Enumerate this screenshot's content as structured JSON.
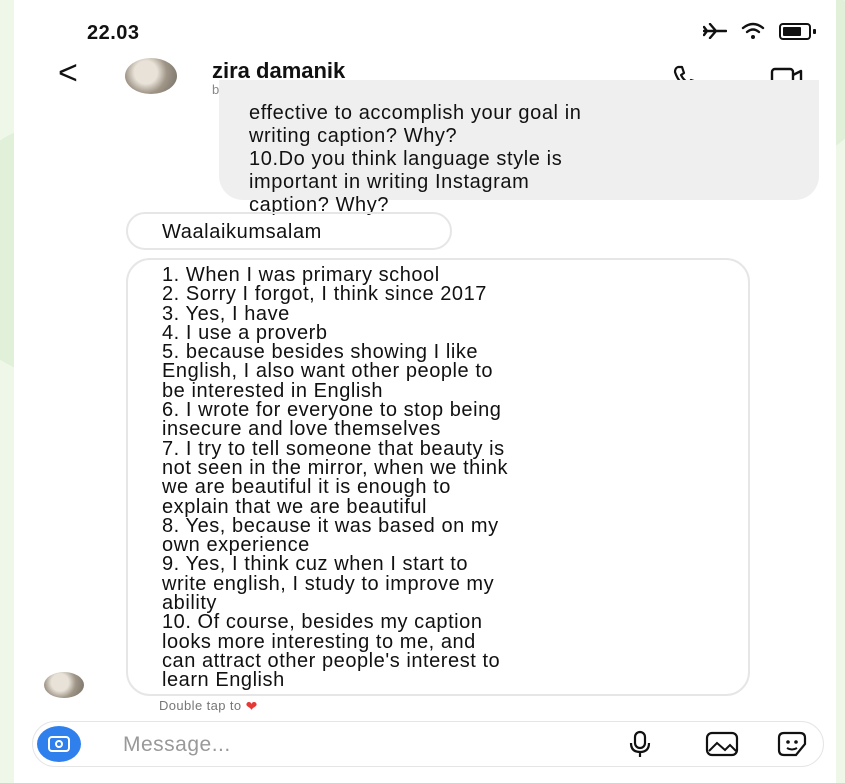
{
  "status_bar": {
    "time": "22.03"
  },
  "header": {
    "name": "zira damanik",
    "handle": "belleviezira"
  },
  "conversation": {
    "sent_text": "effective to accomplish your goal in\nwriting caption? Why?\n10.Do you think language style is\nimportant in writing Instagram\ncaption? Why?",
    "reply_short": "Waalaikumsalam",
    "answer_lines": [
      "1. When I was primary school",
      "2. Sorry I forgot, I think since 2017",
      "3. Yes, I have",
      "4. I use a proverb",
      "5. because besides showing I like",
      "English, I also want other people to",
      "be interested in English",
      "6. I wrote for everyone to stop being",
      "insecure and love themselves",
      "7. I try to tell someone that beauty is",
      "not seen in the mirror, when we think",
      "we are beautiful it is enough to",
      "explain that we are beautiful",
      "8. Yes, because it was based on my",
      "own experience",
      "9. Yes, I think cuz when I start to",
      "write english, I study to improve my",
      "ability",
      "10. Of course, besides my caption",
      "looks more interesting to me, and",
      "can attract other people's interest to",
      "learn English"
    ],
    "hint": "Double tap to"
  },
  "composer": {
    "placeholder": "Message..."
  },
  "icons": {
    "back": "chevron-left-icon",
    "call": "phone-icon",
    "video": "video-camera-icon",
    "camera": "camera-icon",
    "mic": "microphone-icon",
    "gallery": "image-icon",
    "sticker": "sticker-icon",
    "heart": "heart-icon"
  },
  "colors": {
    "accent": "#2f80ed",
    "heart": "#e53935",
    "bubble_grey": "#efefef"
  }
}
